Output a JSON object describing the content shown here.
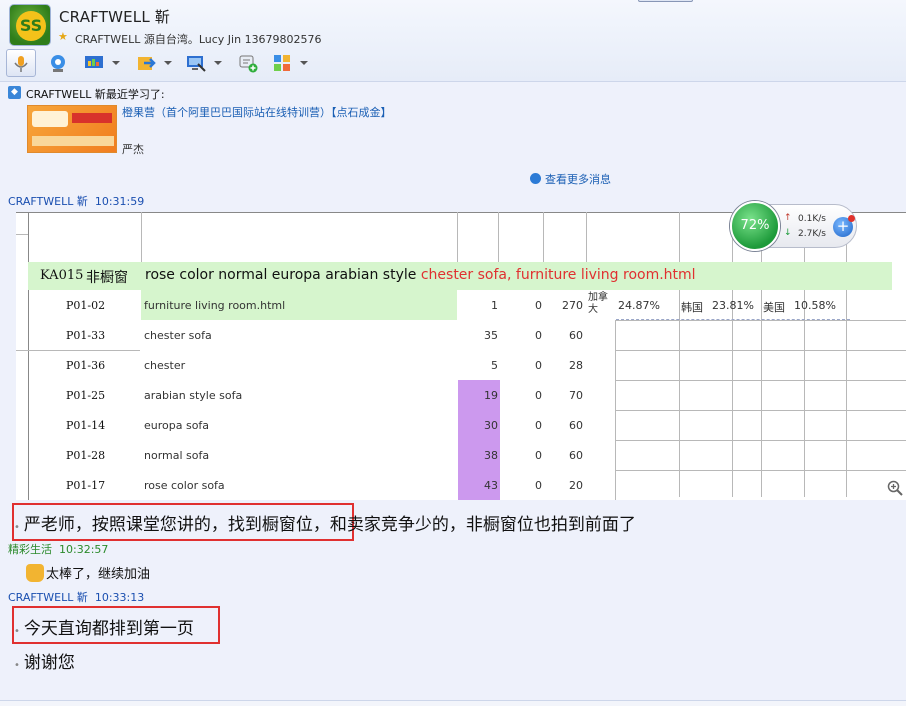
{
  "contact": {
    "name": "CRAFTWELL 靳",
    "signature": "CRAFTWELL 源自台湾。Lucy Jin 13679802576",
    "avatar_text": "SS"
  },
  "toolbar": {
    "items": [
      "microphone-icon",
      "video-icon",
      "screen-share-icon",
      "send-file-icon",
      "remote-desktop-icon",
      "add-contact-icon",
      "app-grid-icon"
    ]
  },
  "feed": {
    "learn_text": "CRAFTWELL 靳最近学习了:",
    "promo_title": "橙果营（首个阿里巴巴国际站在线特训营）【点石成金】",
    "promo_author": "严杰",
    "more_label": "查看更多消息"
  },
  "messages": [
    {
      "sender": "CRAFTWELL 靳",
      "time": "10:31:59"
    },
    {
      "sender": "精彩生活",
      "time": "10:32:57",
      "text": "太棒了，继续加油"
    },
    {
      "sender": "CRAFTWELL 靳",
      "time": "10:33:13",
      "line1": "今天直询都排到第一页",
      "line2": "谢谢您"
    }
  ],
  "main_message": {
    "highlight": "严老师，按照课堂您讲的，找到橱窗位",
    "rest": "，和卖家竞争少的，非橱窗位也拍到前面了"
  },
  "sheet": {
    "product_code": "KA015",
    "product_label": "非橱窗",
    "title_black": "rose color normal europa arabian style",
    "title_red": "chester sofa, furniture living room.html",
    "rows": [
      {
        "id": "P01-02",
        "keyword": "furniture living room.html",
        "a": "1",
        "b": "0",
        "c": "270"
      },
      {
        "id": "P01-33",
        "keyword": "chester sofa",
        "a": "35",
        "b": "0",
        "c": "60"
      },
      {
        "id": "P01-36",
        "keyword": "chester",
        "a": "5",
        "b": "0",
        "c": "28"
      },
      {
        "id": "P01-25",
        "keyword": "arabian style sofa",
        "a": "19",
        "b": "0",
        "c": "70"
      },
      {
        "id": "P01-14",
        "keyword": "europa sofa",
        "a": "30",
        "b": "0",
        "c": "60"
      },
      {
        "id": "P01-28",
        "keyword": "normal sofa",
        "a": "38",
        "b": "0",
        "c": "60"
      },
      {
        "id": "P01-17",
        "keyword": "rose color sofa",
        "a": "43",
        "b": "0",
        "c": "20"
      }
    ],
    "country_stats": [
      {
        "country": "加拿大",
        "pct": "24.87%"
      },
      {
        "country": "韩国",
        "pct": "23.81%"
      },
      {
        "country": "美国",
        "pct": "10.58%"
      }
    ]
  },
  "perf_widget": {
    "percent": "72%",
    "up_rate": "0.1K/s",
    "down_rate": "2.7K/s"
  },
  "colors": {
    "highlight_red": "#e03030",
    "sheet_green": "#d6f5cd",
    "sheet_purple": "#cc99ee",
    "link_blue": "#1a5fb4"
  }
}
